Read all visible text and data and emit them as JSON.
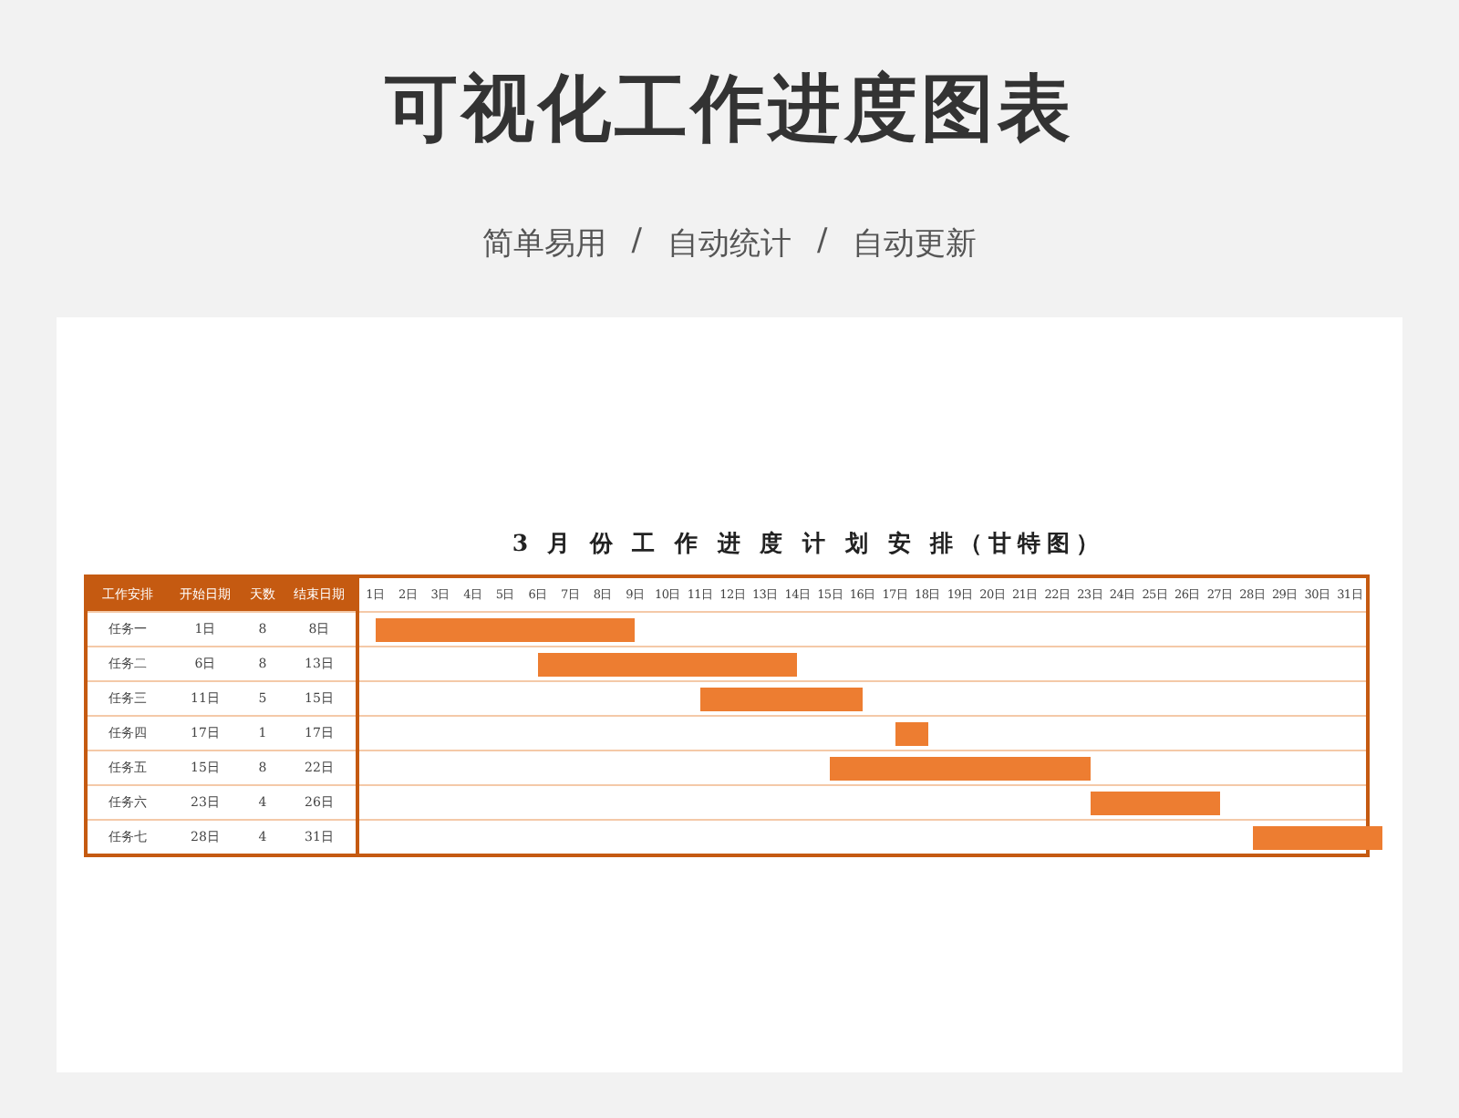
{
  "title": "可视化工作进度图表",
  "subtitle": [
    "简单易用",
    "自动统计",
    "自动更新"
  ],
  "separator": "/",
  "chart_title": "3 月 份 工 作 进 度 计 划 安 排（甘特图）",
  "table": {
    "columns": [
      "工作安排",
      "开始日期",
      "天数",
      "结束日期"
    ],
    "rows": [
      {
        "task": "任务一",
        "start": "1日",
        "days": "8",
        "end": "8日"
      },
      {
        "task": "任务二",
        "start": "6日",
        "days": "8",
        "end": "13日"
      },
      {
        "task": "任务三",
        "start": "11日",
        "days": "5",
        "end": "15日"
      },
      {
        "task": "任务四",
        "start": "17日",
        "days": "1",
        "end": "17日"
      },
      {
        "task": "任务五",
        "start": "15日",
        "days": "8",
        "end": "22日"
      },
      {
        "task": "任务六",
        "start": "23日",
        "days": "4",
        "end": "26日"
      },
      {
        "task": "任务七",
        "start": "28日",
        "days": "4",
        "end": "31日"
      }
    ]
  },
  "gantt_days": [
    "1日",
    "2日",
    "3日",
    "4日",
    "5日",
    "6日",
    "7日",
    "8日",
    "9日",
    "10日",
    "11日",
    "12日",
    "13日",
    "14日",
    "15日",
    "16日",
    "17日",
    "18日",
    "19日",
    "20日",
    "21日",
    "22日",
    "23日",
    "24日",
    "25日",
    "26日",
    "27日",
    "28日",
    "29日",
    "30日",
    "31日"
  ]
}
